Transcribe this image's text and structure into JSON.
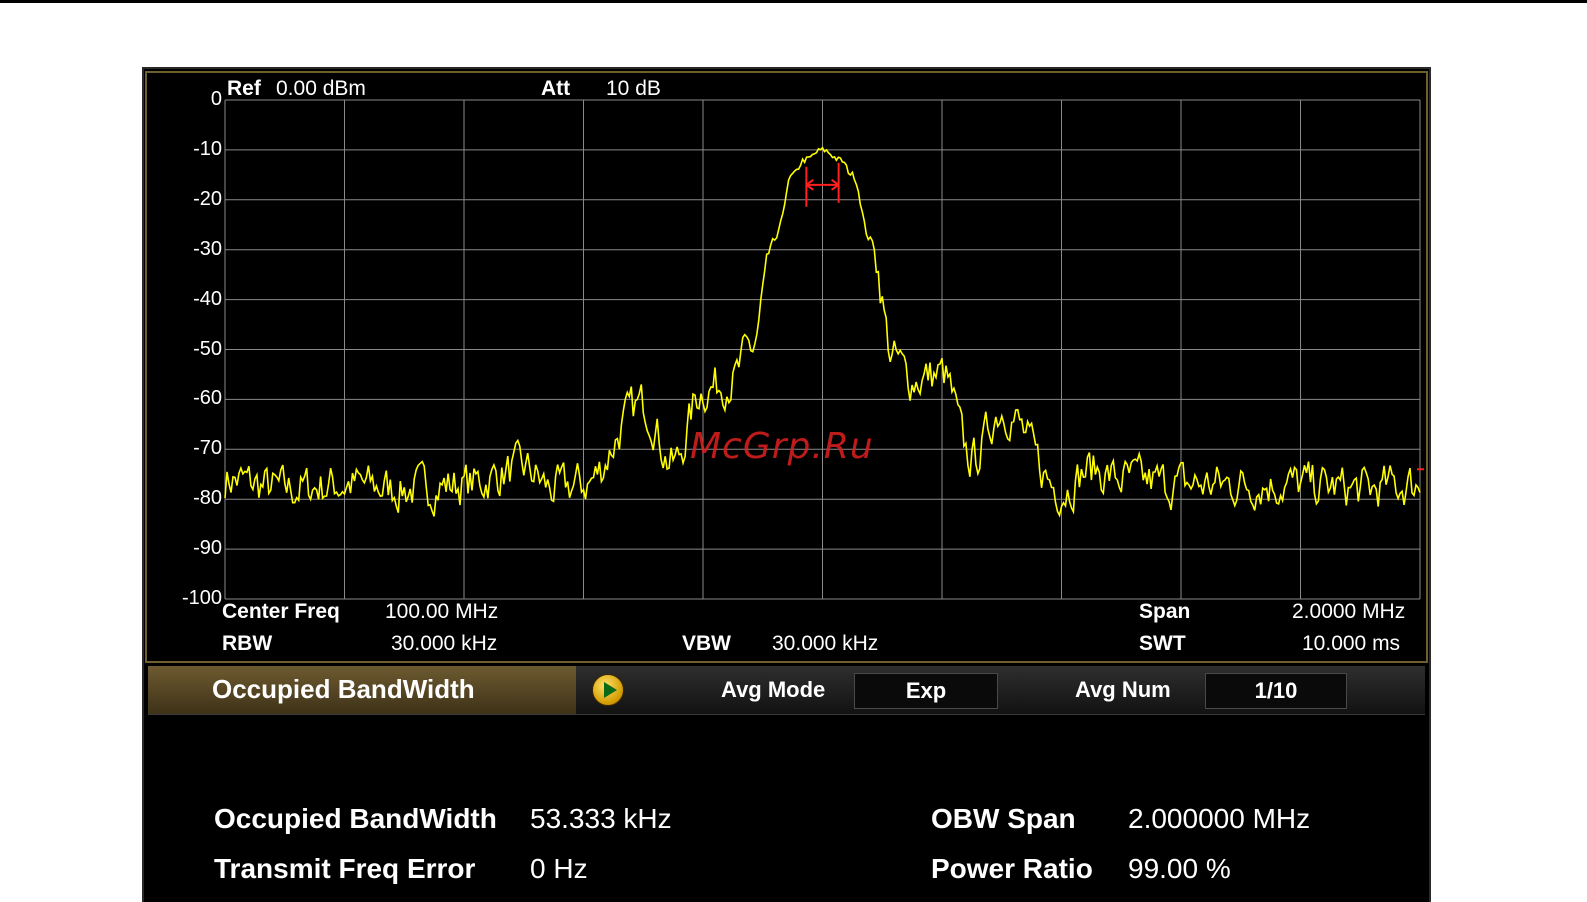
{
  "header": {
    "ref_label": "Ref",
    "ref_value": "0.00 dBm",
    "att_label": "Att",
    "att_value": "10 dB"
  },
  "footer": {
    "center_freq_label": "Center Freq",
    "center_freq_value": "100.00 MHz",
    "rbw_label": "RBW",
    "rbw_value": "30.000 kHz",
    "vbw_label": "VBW",
    "vbw_value": "30.000 kHz",
    "span_label": "Span",
    "span_value": "2.0000 MHz",
    "swt_label": "SWT",
    "swt_value": "10.000 ms"
  },
  "chart_data": {
    "type": "line",
    "ylim": [
      -100,
      0
    ],
    "y_ticks": [
      "0",
      "-10",
      "-20",
      "-30",
      "-40",
      "-50",
      "-60",
      "-70",
      "-80",
      "-90",
      "-100"
    ],
    "x_center_mhz": 100.0,
    "x_span_mhz": 2.0,
    "grid": true,
    "trace_color": "#ffff00",
    "marker_color": "#ff2020",
    "series": [
      {
        "x": [
          -1.0,
          -0.9,
          -0.8,
          -0.7,
          -0.6,
          -0.5,
          -0.45,
          -0.4,
          -0.3,
          -0.25,
          -0.2,
          -0.15,
          -0.12,
          -0.08,
          -0.05,
          -0.03,
          0.0,
          0.03,
          0.05,
          0.08,
          0.12,
          0.15,
          0.2,
          0.25,
          0.3,
          0.4,
          0.45,
          0.5,
          0.6,
          0.7,
          0.8,
          0.9,
          1.0
        ],
        "y": [
          -76,
          -78,
          -77,
          -78,
          -77,
          -74,
          -78,
          -77,
          -61,
          -73,
          -58,
          -56,
          -50,
          -28,
          -15,
          -12,
          -10,
          -12,
          -15,
          -28,
          -52,
          -56,
          -55,
          -72,
          -62,
          -78,
          -74,
          -76,
          -77,
          -77,
          -77,
          -78,
          -77
        ]
      }
    ],
    "obw_marker_left_mhz": -0.027,
    "obw_marker_right_mhz": 0.027
  },
  "toolbar": {
    "mode_title": "Occupied BandWidth",
    "avg_mode_label": "Avg Mode",
    "avg_mode_value": "Exp",
    "avg_num_label": "Avg Num",
    "avg_num_value": "1/10"
  },
  "results": {
    "obw_label": "Occupied BandWidth",
    "obw_value": "53.333 kHz",
    "tfe_label": "Transmit Freq Error",
    "tfe_value": "0 Hz",
    "obw_span_label": "OBW Span",
    "obw_span_value": "2.000000 MHz",
    "power_ratio_label": "Power Ratio",
    "power_ratio_value": "99.00 %"
  },
  "watermark": "McGrp.Ru",
  "colors": {
    "background": "#000000",
    "grid": "#8a8a8a",
    "frame": "#6e5f2e",
    "tab": "#6d5a30"
  }
}
